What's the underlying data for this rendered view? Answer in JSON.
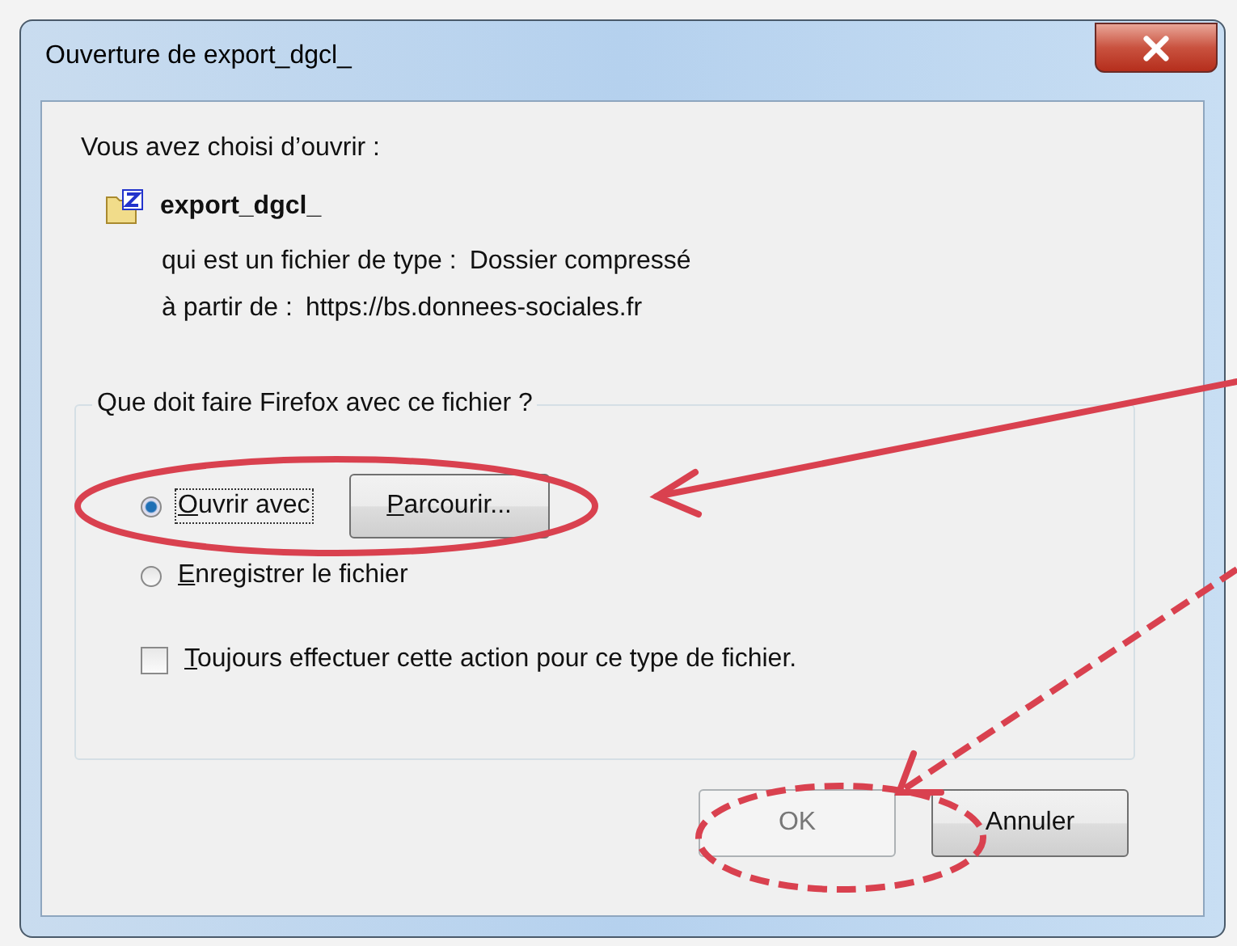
{
  "window": {
    "title": "Ouverture de export_dgcl_"
  },
  "intro": "Vous avez choisi d’ouvrir :",
  "file": {
    "name": "export_dgcl_",
    "type_label": "qui est un fichier de type :",
    "type_value": "Dossier compressé",
    "source_label": "à partir de :",
    "source_value": "https://bs.donnees-sociales.fr"
  },
  "group": {
    "legend": "Que doit faire Firefox avec ce fichier ?",
    "options": [
      {
        "kind": "radio",
        "label": "Ouvrir avec",
        "selected": true,
        "button": "Parcourir..."
      },
      {
        "kind": "radio",
        "label": "Enregistrer le fichier",
        "selected": false
      },
      {
        "kind": "checkbox",
        "label": "Toujours effectuer cette action pour ce type de fichier.",
        "checked": false
      }
    ]
  },
  "buttons": [
    {
      "label": "OK",
      "disabled": true
    },
    {
      "label": "Annuler",
      "disabled": false
    }
  ]
}
